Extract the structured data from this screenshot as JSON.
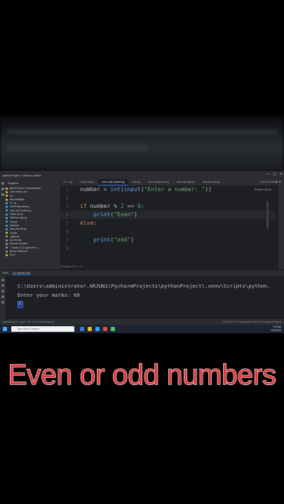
{
  "window": {
    "title": "pythonProject  ›  Version control",
    "controls": [
      "—",
      "▢",
      "✕"
    ]
  },
  "tabs": [
    {
      "label": "C: \\...py"
    },
    {
      "label": "if else cal.py"
    },
    {
      "label": "even odd number.py",
      "active": true
    },
    {
      "label": "loop.py"
    },
    {
      "label": "check leap year.py"
    },
    {
      "label": "interview age.py"
    },
    {
      "label": "leap year list.py"
    }
  ],
  "toolbar_right": "Current File  ▶  ⚙",
  "project_panel": {
    "header": "Project  ▾",
    "items": [
      {
        "label": "pythonProject  C:\\Users\\admin...",
        "color": "#e3b341"
      },
      {
        "label": "  .venv  library root",
        "color": "#e3b341"
      },
      {
        "label": "    Lib",
        "color": "#e3b341"
      },
      {
        "label": "      site-packages",
        "color": "#e3b341"
      },
      {
        "label": "        fn...py",
        "color": "#3aa0ff"
      },
      {
        "label": "        check leap year.py",
        "color": "#3aa0ff"
      },
      {
        "label": "        even odd number.py",
        "color": "#3aa0ff"
      },
      {
        "label": "        if else cal.py",
        "color": "#3aa0ff"
      },
      {
        "label": "        interview age.py",
        "color": "#3aa0ff"
      },
      {
        "label": "        loop.py",
        "color": "#3aa0ff"
      },
      {
        "label": "        game.py",
        "color": "#3aa0ff"
      },
      {
        "label": "        leap year list.py",
        "color": "#3aa0ff"
      },
      {
        "label": "    Scripts",
        "color": "#e3b341"
      },
      {
        "label": "    .gitignore",
        "color": "#8c9097"
      },
      {
        "label": "    pyvenv.cfg",
        "color": "#8c9097"
      },
      {
        "label": "External Libraries",
        "color": "#8c9097"
      },
      {
        "label": "  < Python 3.12 (pythonPro... >",
        "color": "#8c9097"
      },
      {
        "label": "    Binary Skeletons",
        "color": "#8c9097"
      },
      {
        "label": "    DLLs",
        "color": "#e3b341"
      }
    ]
  },
  "editor": {
    "reader_mode": "Reader Mode",
    "breadcrumb": "if number % 2 == 0",
    "line_numbers": [
      "1",
      "2",
      "3",
      "4",
      "5",
      "6",
      "7",
      "8"
    ],
    "lines": {
      "l1": {
        "a": "number = ",
        "b": "int",
        "c": "(",
        "d": "input",
        "e": "(",
        "f": "\"Enter a number: \"",
        "g": "))"
      },
      "l3": {
        "a": "if ",
        "b": "number % ",
        "c": "2",
        "d": " == ",
        "e": "0",
        "f": ":"
      },
      "l4": {
        "a": "    ",
        "b": "print",
        "c": "(",
        "d": "\"Even\"",
        "e": ")"
      },
      "l5": {
        "a": "else",
        "b": ":"
      },
      "l7": {
        "a": "    ",
        "b": "print",
        "c": "(",
        "d": "\"odd\"",
        "e": ")"
      }
    }
  },
  "run_panel": {
    "tabs": [
      "Run:",
      "Dr. onsole.Run"
    ],
    "console": [
      "C:\\Users\\administrator.ARJUN1\\PycharmProjects\\pythonProject\\.venv\\Scripts\\python.",
      "Enter your marks: 69"
    ],
    "input_value": "0"
  },
  "status_bar": {
    "left": "pythonProject  ›  .venv  ›  Lib  ›  even odd number.py",
    "right": "4:16   CRLF   UTF-8   4 spaces   Python 3.12 (pythonProject)"
  },
  "taskbar": {
    "search_placeholder": "Type here to search",
    "time": "7:00 AM",
    "date": "1/10/2023",
    "icon_colors": [
      "#3a7bd5",
      "#f0b429",
      "#2fa3f7",
      "#e04b2f",
      "#4ec26d"
    ]
  },
  "caption": "Even or odd numbers"
}
